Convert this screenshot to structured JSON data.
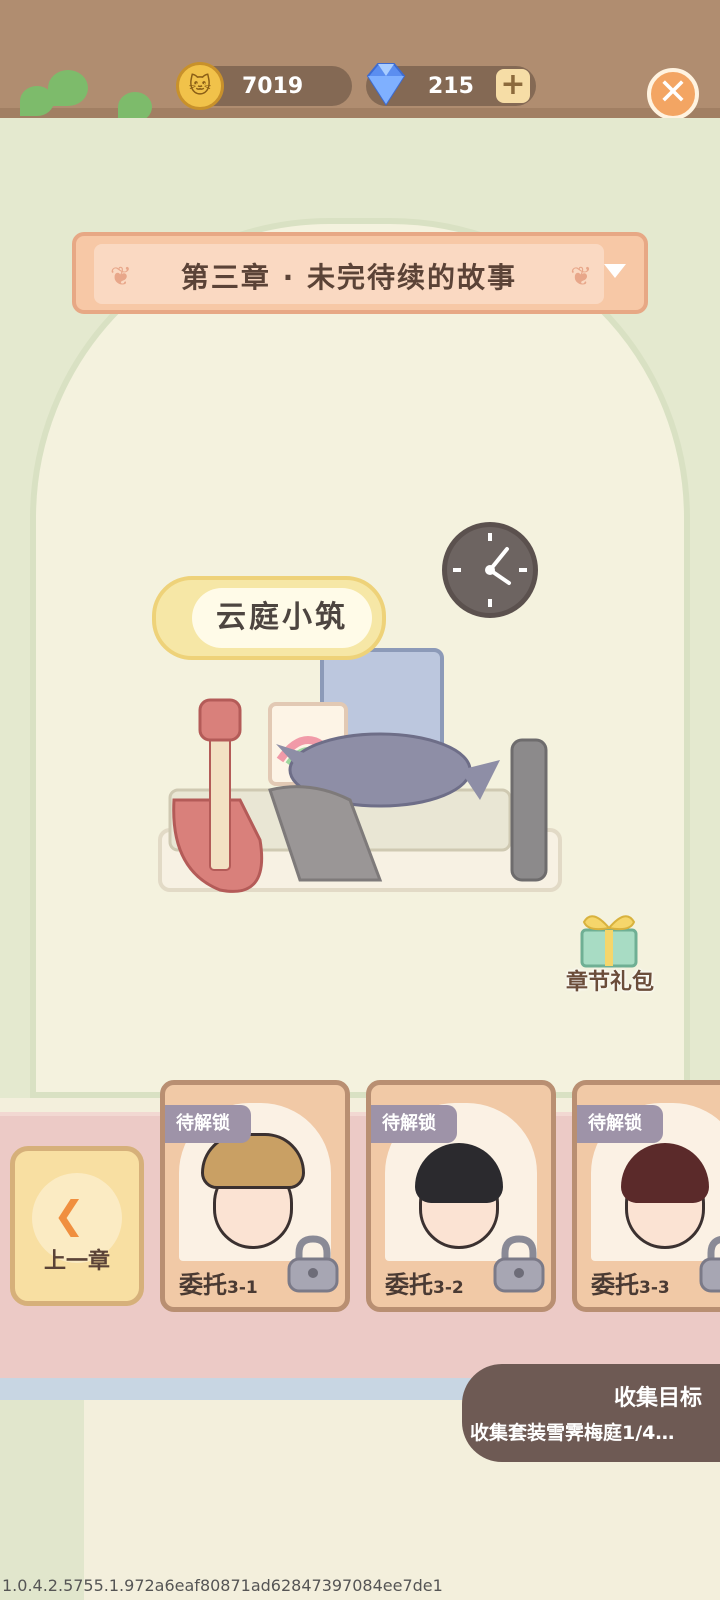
{
  "currency": {
    "coins": "7019",
    "gems": "215"
  },
  "chapter": {
    "title": "第三章 · 未完待续的故事"
  },
  "room": {
    "name": "云庭小筑"
  },
  "gift": {
    "label": "章节礼包"
  },
  "prev_chapter": {
    "label": "上一章"
  },
  "commissions": [
    {
      "tag": "待解锁",
      "name": "委托",
      "num": "3-1",
      "locked": true
    },
    {
      "tag": "待解锁",
      "name": "委托",
      "num": "3-2",
      "locked": true
    },
    {
      "tag": "待解锁",
      "name": "委托",
      "num": "3-3",
      "locked": true
    }
  ],
  "goal": {
    "title": "收集目标",
    "desc": "收集套装雪霁梅庭1/4…"
  },
  "build": "1.0.4.2.5755.1.972a6eaf80871ad62847397084ee7de1",
  "icons": {
    "coin": "cat-coin-icon",
    "gem": "diamond-icon",
    "add": "plus-icon",
    "close": "close-icon",
    "lock": "lock-icon",
    "gift": "gift-box-icon",
    "prev": "back-arrow-icon",
    "clock": "clock-icon"
  }
}
